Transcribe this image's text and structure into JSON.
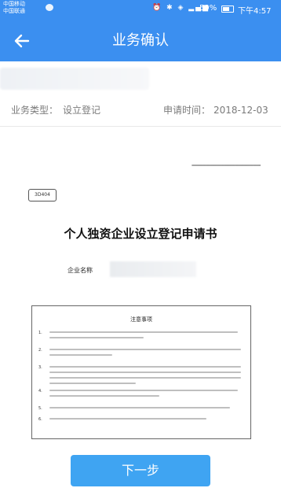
{
  "status_bar": {
    "carrier_1": "中国移动",
    "carrier_2": "中国联通",
    "icons": "⏰ ✱ ◈ ▂▄▆",
    "battery": "59%",
    "time": "下午4:57"
  },
  "header": {
    "title": "业务确认",
    "back_icon": "back-arrow-icon"
  },
  "business": {
    "type_label": "业务类型：",
    "type_value": "设立登记",
    "date_label": "申请时间：",
    "date_value": "2018-12-03"
  },
  "document": {
    "stamp_text": "3D404",
    "title": "个人独资企业设立登记申请书",
    "company_label": "企业名称"
  },
  "notice": {
    "title": "注意事项",
    "items": [
      "1.",
      "2.",
      "3.",
      "4.",
      "5.",
      "6."
    ]
  },
  "actions": {
    "next_label": "下一步"
  },
  "colors": {
    "header_blue": "#3b8ff0",
    "button_blue": "#3fa4f2"
  }
}
